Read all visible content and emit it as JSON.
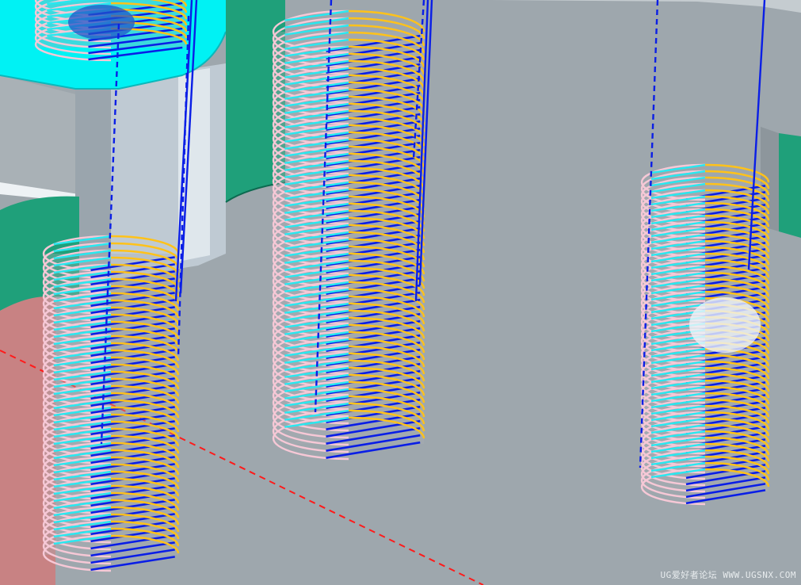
{
  "viewport": {
    "watermark": "UG爱好者论坛 WWW.UGSNX.COM"
  },
  "colors": {
    "background_floor": "#9ea7ad",
    "cyan_surface": "#00ffff",
    "green_wall": "#1fa07a",
    "pink_wall": "#cc8585",
    "toolpath_blue": "#0a1ee6",
    "toolpath_pink": "#f6c8d6",
    "toolpath_cyan": "#28e8f0",
    "toolpath_yellow": "#ffc21a",
    "axis_red": "#ff1a1a"
  },
  "icons": [
    "watermark-text"
  ]
}
